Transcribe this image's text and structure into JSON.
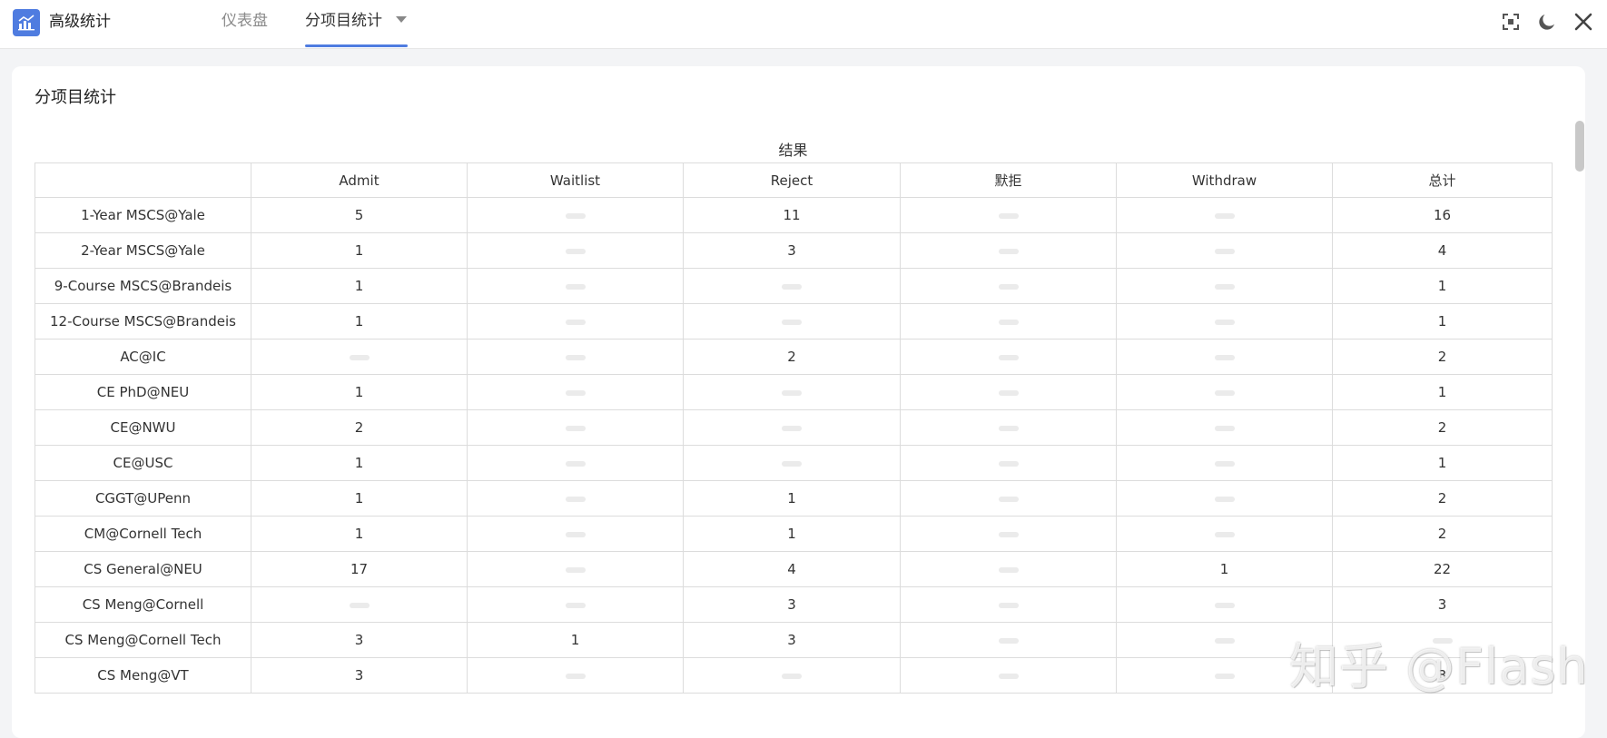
{
  "app": {
    "title": "高级统计"
  },
  "tabs": [
    {
      "label": "仪表盘",
      "active": false
    },
    {
      "label": "分项目统计",
      "active": true
    }
  ],
  "icons": {
    "fullscreen": "fullscreen-icon",
    "theme": "moon-icon",
    "close": "close-icon",
    "logo": "bar-chart-icon"
  },
  "colors": {
    "accent": "#4f7ce0"
  },
  "card": {
    "title": "分项目统计"
  },
  "table": {
    "group_header": "结果",
    "columns": [
      "",
      "Admit",
      "Waitlist",
      "Reject",
      "默拒",
      "Withdraw",
      "总计"
    ],
    "rows": [
      [
        "1-Year MSCS@Yale",
        "5",
        "",
        "11",
        "",
        "",
        "16"
      ],
      [
        "2-Year MSCS@Yale",
        "1",
        "",
        "3",
        "",
        "",
        "4"
      ],
      [
        "9-Course MSCS@Brandeis",
        "1",
        "",
        "",
        "",
        "",
        "1"
      ],
      [
        "12-Course MSCS@Brandeis",
        "1",
        "",
        "",
        "",
        "",
        "1"
      ],
      [
        "AC@IC",
        "",
        "",
        "2",
        "",
        "",
        "2"
      ],
      [
        "CE PhD@NEU",
        "1",
        "",
        "",
        "",
        "",
        "1"
      ],
      [
        "CE@NWU",
        "2",
        "",
        "",
        "",
        "",
        "2"
      ],
      [
        "CE@USC",
        "1",
        "",
        "",
        "",
        "",
        "1"
      ],
      [
        "CGGT@UPenn",
        "1",
        "",
        "1",
        "",
        "",
        "2"
      ],
      [
        "CM@Cornell Tech",
        "1",
        "",
        "1",
        "",
        "",
        "2"
      ],
      [
        "CS General@NEU",
        "17",
        "",
        "4",
        "",
        "1",
        "22"
      ],
      [
        "CS Meng@Cornell",
        "",
        "",
        "3",
        "",
        "",
        "3"
      ],
      [
        "CS Meng@Cornell Tech",
        "3",
        "1",
        "3",
        "",
        "",
        ""
      ],
      [
        "CS Meng@VT",
        "3",
        "",
        "",
        "",
        "",
        "3"
      ]
    ]
  },
  "watermark": "知乎 @Flash"
}
